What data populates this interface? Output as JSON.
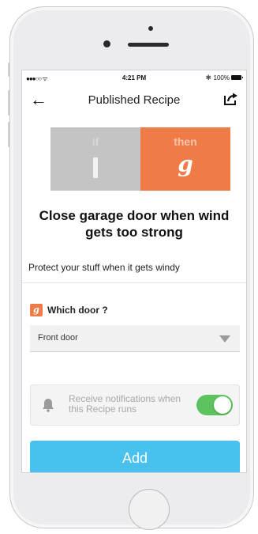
{
  "status_bar": {
    "signal": "●●●○○ ᯤ",
    "time": "4:21 PM",
    "bluetooth": "✱",
    "battery": "100%"
  },
  "nav": {
    "back_glyph": "←",
    "title": "Published Recipe"
  },
  "applet": {
    "if_label": "if",
    "then_label": "then",
    "then_glyph": "g",
    "if_color": "#c4c4c4",
    "then_color": "#ef7b46"
  },
  "recipe": {
    "title": "Close garage door when wind gets too strong",
    "description": "Protect your stuff when it gets windy"
  },
  "field": {
    "icon_glyph": "g",
    "label": "Which door ?",
    "value": "Front door"
  },
  "notifications": {
    "label": "Receive notifications when this Recipe runs",
    "enabled": true,
    "toggle_color": "#5cc35e"
  },
  "actions": {
    "add_label": "Add",
    "add_color": "#48c1ee"
  },
  "icons": [
    "back-arrow-icon",
    "share-icon",
    "bell-icon",
    "chevron-down-icon",
    "battery-icon",
    "bluetooth-icon",
    "wifi-icon"
  ]
}
